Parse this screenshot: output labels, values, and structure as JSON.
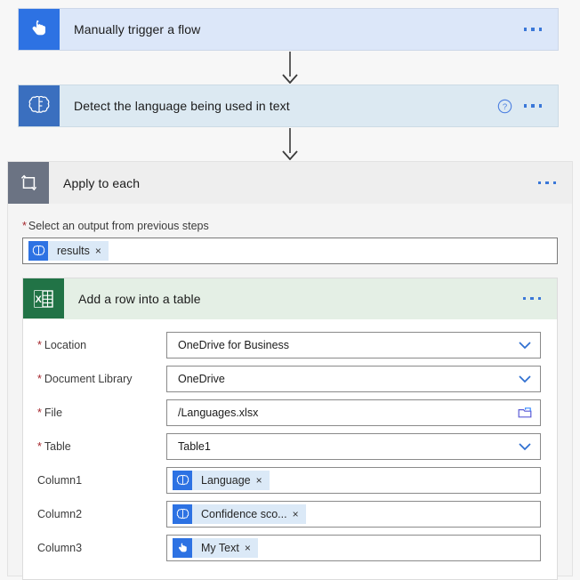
{
  "flow": {
    "trigger": {
      "title": "Manually trigger a flow",
      "icon": "hand-tap-icon",
      "menu_label": "...",
      "bg_color": "#dce7f9",
      "icon_bg": "#2d72e3"
    },
    "detect": {
      "title": "Detect the language being used in text",
      "icon": "brain-icon",
      "help_label": "?",
      "menu_label": "...",
      "bg_color": "#dce9f2",
      "icon_bg": "#3a6fbf"
    },
    "apply_to_each": {
      "title": "Apply to each",
      "icon": "loop-icon",
      "menu_label": "...",
      "icon_bg": "#6b7383",
      "select_output": {
        "required": "*",
        "label": "Select an output from previous steps",
        "token": {
          "label": "results",
          "icon": "brain-icon",
          "close_label": "×"
        }
      }
    },
    "excel_action": {
      "title": "Add a row into a table",
      "icon": "excel-icon",
      "menu_label": "...",
      "icon_bg": "#217346",
      "header_bg": "#e4efe5",
      "fields": [
        {
          "required": "*",
          "label": "Location",
          "value": "OneDrive for Business",
          "control": "dropdown"
        },
        {
          "required": "*",
          "label": "Document Library",
          "value": "OneDrive",
          "control": "dropdown"
        },
        {
          "required": "*",
          "label": "File",
          "value": "/Languages.xlsx",
          "control": "file-picker"
        },
        {
          "required": "*",
          "label": "Table",
          "value": "Table1",
          "control": "dropdown"
        }
      ],
      "column_fields": [
        {
          "label": "Column1",
          "token": {
            "label": "Language",
            "icon": "brain-icon",
            "close_label": "×"
          }
        },
        {
          "label": "Column2",
          "token": {
            "label": "Confidence sco...",
            "icon": "brain-icon",
            "close_label": "×"
          }
        },
        {
          "label": "Column3",
          "token": {
            "label": "My Text",
            "icon": "hand-tap-icon",
            "close_label": "×"
          }
        }
      ]
    },
    "colors": {
      "accent_blue": "#2d72e3",
      "required_red": "#a4262c",
      "excel_green": "#217346",
      "loop_gray": "#6b7383",
      "connector": "#3b3b3b"
    }
  }
}
